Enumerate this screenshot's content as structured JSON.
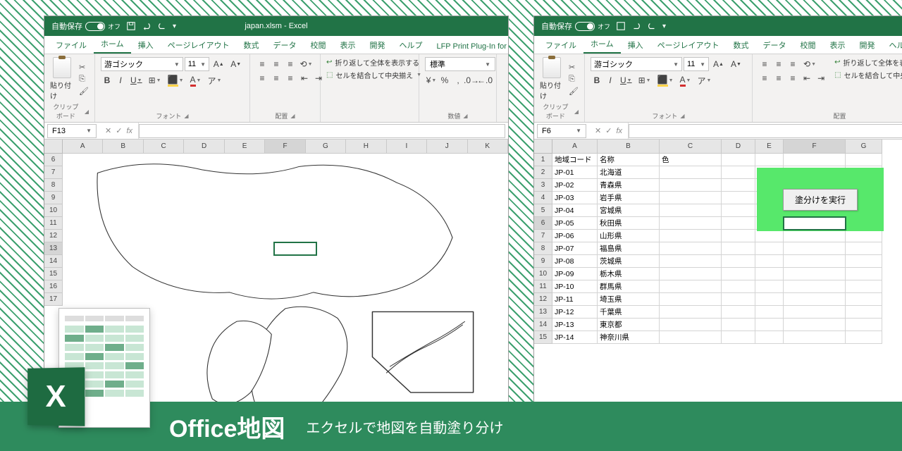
{
  "window1": {
    "titlebar": {
      "autosave_label": "自動保存",
      "autosave_state": "オフ",
      "title": "japan.xlsm - Excel"
    },
    "tabs": [
      "ファイル",
      "ホーム",
      "挿入",
      "ページレイアウト",
      "数式",
      "データ",
      "校閲",
      "表示",
      "開発",
      "ヘルプ",
      "LFP Print Plug-In for Office"
    ],
    "active_tab": 1,
    "ribbon": {
      "clipboard_label": "クリップボード",
      "paste_label": "貼り付け",
      "font_label": "フォント",
      "font_name": "游ゴシック",
      "font_size": "11",
      "align_label": "配置",
      "wrap_label": "折り返して全体を表示する",
      "merge_label": "セルを結合して中央揃え",
      "number_label": "数値",
      "number_format": "標準"
    },
    "namebox": "F13",
    "columns": [
      "A",
      "B",
      "C",
      "D",
      "E",
      "F",
      "G",
      "H",
      "I",
      "J",
      "K"
    ],
    "rows": [
      6,
      7,
      8,
      9,
      10,
      11,
      12,
      13,
      14,
      15,
      16,
      17
    ],
    "selected_col": "F",
    "selected_row": 13
  },
  "window2": {
    "titlebar": {
      "autosave_label": "自動保存",
      "autosave_state": "オフ"
    },
    "tabs": [
      "ファイル",
      "ホーム",
      "挿入",
      "ページレイアウト",
      "数式",
      "データ",
      "校閲",
      "表示",
      "開発",
      "ヘルプ"
    ],
    "active_tab": 1,
    "ribbon": {
      "clipboard_label": "クリップボード",
      "paste_label": "貼り付け",
      "font_label": "フォント",
      "font_name": "游ゴシック",
      "font_size": "11",
      "align_label": "配置",
      "wrap_label": "折り返して全体を表",
      "merge_label": "セルを結合して中央"
    },
    "namebox": "F6",
    "columns": [
      "A",
      "B",
      "C",
      "D",
      "E",
      "F",
      "G"
    ],
    "selected_col": "F",
    "selected_row": 6,
    "header_row": {
      "A": "地域コード",
      "B": "名称",
      "C": "色"
    },
    "data_rows": [
      {
        "n": 2,
        "A": "JP-01",
        "B": "北海道"
      },
      {
        "n": 3,
        "A": "JP-02",
        "B": "青森県"
      },
      {
        "n": 4,
        "A": "JP-03",
        "B": "岩手県"
      },
      {
        "n": 5,
        "A": "JP-04",
        "B": "宮城県"
      },
      {
        "n": 6,
        "A": "JP-05",
        "B": "秋田県"
      },
      {
        "n": 7,
        "A": "JP-06",
        "B": "山形県"
      },
      {
        "n": 8,
        "A": "JP-07",
        "B": "福島県"
      },
      {
        "n": 9,
        "A": "JP-08",
        "B": "茨城県"
      },
      {
        "n": 10,
        "A": "JP-09",
        "B": "栃木県"
      },
      {
        "n": 11,
        "A": "JP-10",
        "B": "群馬県"
      },
      {
        "n": 12,
        "A": "JP-11",
        "B": "埼玉県"
      },
      {
        "n": 13,
        "A": "JP-12",
        "B": "千葉県"
      },
      {
        "n": 14,
        "A": "JP-13",
        "B": "東京都"
      },
      {
        "n": 15,
        "A": "JP-14",
        "B": "神奈川県"
      }
    ],
    "exec_button": "塗分けを実行"
  },
  "banner": {
    "title": "Office地図",
    "subtitle": "エクセルで地図を自動塗り分け",
    "logo_letter": "X"
  }
}
